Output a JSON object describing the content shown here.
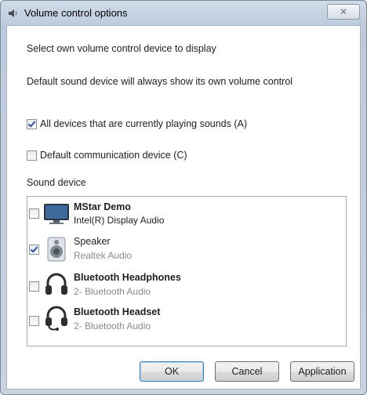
{
  "window": {
    "title": "Volume control options",
    "close_label": "✕"
  },
  "instructions": {
    "line1": "Select own volume control device to display",
    "line2": "Default sound device will always show its own volume control"
  },
  "options": {
    "playing": {
      "label": "All devices that are currently playing sounds (A)",
      "checked": true
    },
    "communication": {
      "label": "Default communication device (C)",
      "checked": false
    }
  },
  "sound_device": {
    "label": "Sound device",
    "devices": [
      {
        "name": "MStar Demo",
        "sub": "Intel(R) Display Audio",
        "checked": false,
        "icon": "monitor-icon"
      },
      {
        "name": "Speaker",
        "sub": "Realtek Audio",
        "checked": true,
        "icon": "speaker-icon"
      },
      {
        "name": "Bluetooth Headphones",
        "sub": "2- Bluetooth Audio",
        "checked": false,
        "icon": "headphones-icon"
      },
      {
        "name": "Bluetooth Headset",
        "sub": "2- Bluetooth Audio",
        "checked": false,
        "icon": "headset-icon"
      }
    ]
  },
  "buttons": {
    "ok": "OK",
    "cancel": "Cancel",
    "application": "Application"
  }
}
